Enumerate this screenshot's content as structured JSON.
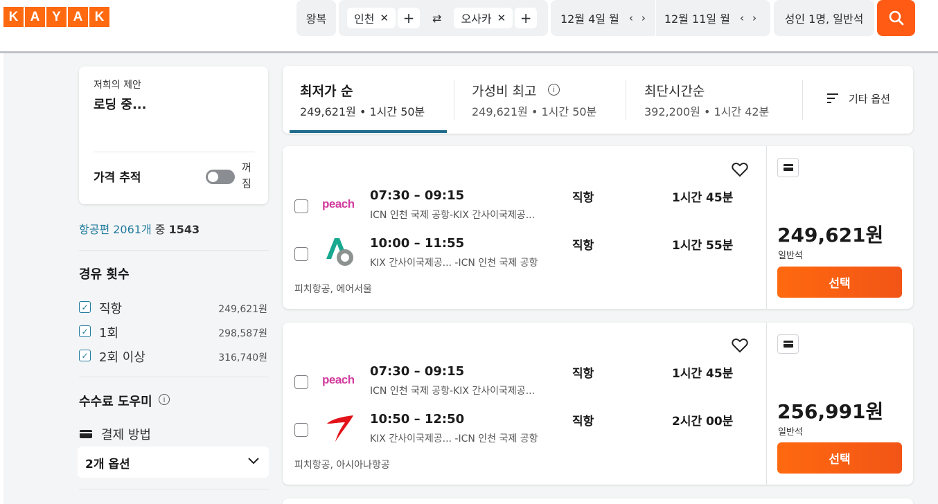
{
  "header": {
    "logo_letters": [
      "K",
      "A",
      "Y",
      "A",
      "K"
    ],
    "trip_type": "왕복",
    "origin": "인천",
    "destination": "오사카",
    "swap_symbol": "⇄",
    "depart_date": "12월 4일 월",
    "return_date": "12월 11일 월",
    "travelers": "성인 1명, 일반석",
    "accent": "#ff690f"
  },
  "sidebar": {
    "offer_title": "저희의 제안",
    "offer_status": "로딩 중...",
    "price_track_label": "가격 추적",
    "price_track_state": "꺼짐",
    "count_prefix": "항공편 2061개",
    "count_mid": "중",
    "count_value": "1543",
    "stops_title": "경유 횟수",
    "stops": [
      {
        "label": "직항",
        "price": "249,621원"
      },
      {
        "label": "1회",
        "price": "298,587원"
      },
      {
        "label": "2회 이상",
        "price": "316,740원"
      }
    ],
    "fee_title": "수수료 도우미",
    "payment_label": "결제 방법",
    "payment_select": "2개 옵션"
  },
  "sort": {
    "tabs": [
      {
        "label": "최저가 순",
        "sub": "249,621원 • 1시간 50분"
      },
      {
        "label": "가성비 최고",
        "sub": "249,621원 • 1시간 50분"
      },
      {
        "label": "최단시간순",
        "sub": "392,200원 • 1시간 42분"
      }
    ],
    "more": "기타 옵션"
  },
  "results": [
    {
      "legs": [
        {
          "airline": "peach",
          "time": "07:30 – 09:15",
          "route": "ICN 인천 국제 공항-KIX 간사이국제공...",
          "stops": "직항",
          "duration": "1시간 45분"
        },
        {
          "airline": "airseoul",
          "time": "10:00 – 11:55",
          "route": "KIX 간사이국제공... -ICN 인천 국제 공항",
          "stops": "직항",
          "duration": "1시간 55분"
        }
      ],
      "carriers": "피치항공, 에어서울",
      "price": "249,621원",
      "cabin": "일반석",
      "select": "선택"
    },
    {
      "legs": [
        {
          "airline": "peach",
          "time": "07:30 – 09:15",
          "route": "ICN 인천 국제 공항-KIX 간사이국제공...",
          "stops": "직항",
          "duration": "1시간 45분"
        },
        {
          "airline": "asiana",
          "time": "10:50 – 12:50",
          "route": "KIX 간사이국제공... -ICN 인천 국제 공항",
          "stops": "직항",
          "duration": "2시간 00분"
        }
      ],
      "carriers": "피치항공, 아시아나항공",
      "price": "256,991원",
      "cabin": "일반석",
      "select": "선택"
    }
  ],
  "airline_logos": {
    "peach": "peach"
  }
}
